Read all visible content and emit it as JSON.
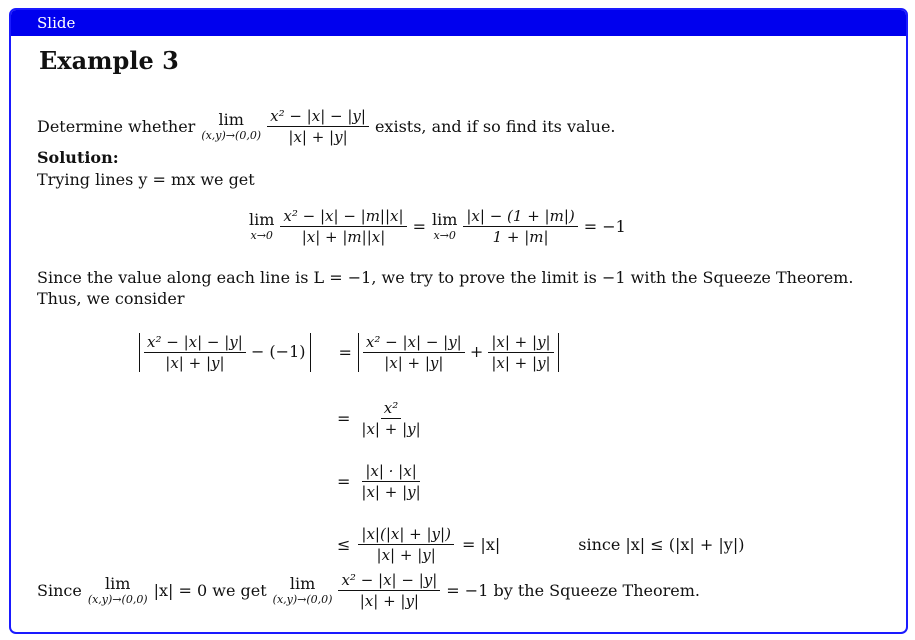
{
  "frame": {
    "title": "Slide"
  },
  "heading": "Example 3",
  "lines": {
    "l1_pre": "Determine whether",
    "l1_lim": "lim",
    "l1_sub": "(x,y)→(0,0)",
    "l1_num": "x² − |x| − |y|",
    "l1_den": "|x| + |y|",
    "l1_post": "exists, and if so find its value.",
    "solution": "Solution:",
    "l2": "Trying lines y = mx we get",
    "eq1_lim_sub": "x→0",
    "eq1_num1": "x² − |x| − |m||x|",
    "eq1_den1": "|x| + |m||x|",
    "eq1_num2": "|x| − (1 + |m|)",
    "eq1_den2": "1 + |m|",
    "eq1_rhs": "= −1",
    "eq1_eq": "=",
    "eq1_lim": "lim",
    "l3": "Since the value along each line is L = −1, we try to prove the limit is −1 with the Squeeze Theorem.",
    "l4": "Thus, we consider",
    "a_num": "x² − |x| − |y|",
    "a_den": "|x| + |y|",
    "a_tail": "− (−1)",
    "a_eq": "=",
    "a_plus": "+",
    "a_num2": "|x| + |y|",
    "b_num": "x²",
    "c_num": "|x| · |x|",
    "d_num": "|x|(|x| + |y|)",
    "d_rel": "≤",
    "d_rhs": "= |x|",
    "d_note": "since |x| ≤ (|x| + |y|)",
    "last_pre": "Since",
    "last_mid": "|x| = 0 we get",
    "last_post": "= −1 by the Squeeze Theorem."
  }
}
